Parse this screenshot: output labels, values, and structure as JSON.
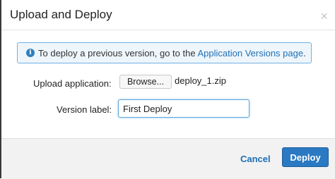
{
  "dialog": {
    "title": "Upload and Deploy",
    "close_glyph": "×"
  },
  "info": {
    "icon": "info-icon",
    "icon_glyph": "i",
    "text": "To deploy a previous version, go to the ",
    "link": "Application Versions page",
    "suffix": ".",
    "accent_color": "#6fb2e4"
  },
  "form": {
    "upload_label": "Upload application:",
    "browse_label": "Browse...",
    "filename": "deploy_1.zip",
    "version_label": "Version label:",
    "version_value": "First Deploy"
  },
  "footer": {
    "cancel_label": "Cancel",
    "deploy_label": "Deploy",
    "primary_color": "#2a79c2"
  }
}
